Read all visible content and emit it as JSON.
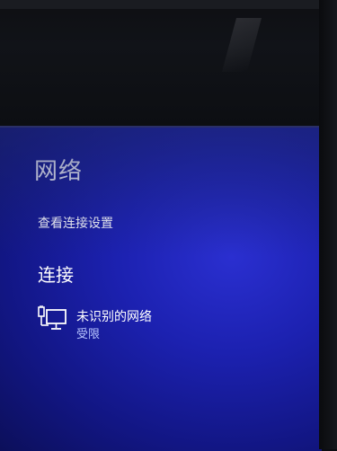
{
  "panel": {
    "title": "网络",
    "settings_link": "查看连接设置",
    "section_title": "连接"
  },
  "connections": [
    {
      "name": "未识别的网络",
      "status": "受限",
      "icon": "ethernet-monitor-icon"
    }
  ],
  "colors": {
    "panel_background": "#1c21b0",
    "text": "#ffffff",
    "status_text": "#b9c6ff"
  }
}
